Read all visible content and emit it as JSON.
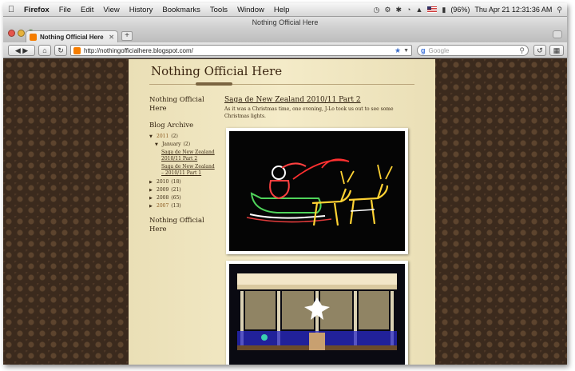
{
  "menubar": {
    "app": "Firefox",
    "items": [
      "File",
      "Edit",
      "View",
      "History",
      "Bookmarks",
      "Tools",
      "Window",
      "Help"
    ],
    "battery": "(96%)",
    "clock": "Thu Apr 21  12:31:36 AM"
  },
  "window": {
    "title": "Nothing Official Here"
  },
  "tab": {
    "label": "Nothing Official Here"
  },
  "navbar": {
    "url": "http://nothingofficialhere.blogspot.com/",
    "search_placeholder": "Google"
  },
  "blog": {
    "title": "Nothing Official Here",
    "sidebar": {
      "header_top": "Nothing Official Here",
      "archive_title": "Blog Archive",
      "archive": {
        "y2011": "2011",
        "y2011_count": "(2)",
        "jan": "January",
        "jan_count": "(2)",
        "post1": "Saga de New Zealand 2010/11 Part 2",
        "post2": "Saga de New Zealand – 2010/11 Part 1",
        "y2010": "2010",
        "y2010_count": "(18)",
        "y2009": "2009",
        "y2009_count": "(21)",
        "y2008": "2008",
        "y2008_count": "(65)",
        "y2007": "2007",
        "y2007_count": "(13)"
      },
      "header_bottom": "Nothing Official Here"
    },
    "post": {
      "title": "Saga de New Zealand 2010/11 Part 2",
      "body": "As it was a Christmas time, one evening, J-Lo took us out to see some Christmas lights."
    }
  },
  "colors": {
    "page_bg": "#3b2a1d",
    "column_bg": "#f4ebc8",
    "link": "#8a5a1f",
    "text": "#2d1d0c"
  }
}
